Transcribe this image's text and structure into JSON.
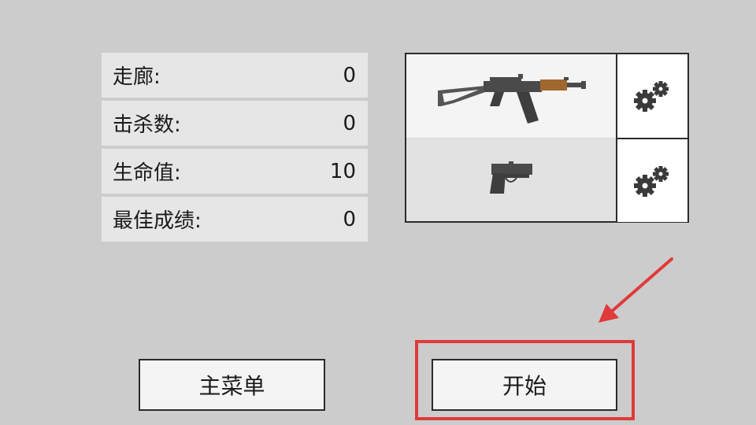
{
  "stats": [
    {
      "label": "走廊:",
      "value": "0"
    },
    {
      "label": "击杀数:",
      "value": "0"
    },
    {
      "label": "生命值:",
      "value": "10"
    },
    {
      "label": "最佳成绩:",
      "value": "0"
    }
  ],
  "weapons": {
    "primary": {
      "icon": "assault-rifle-icon",
      "settings_icon": "gears-icon"
    },
    "secondary": {
      "icon": "pistol-icon",
      "settings_icon": "gears-icon"
    }
  },
  "buttons": {
    "main_menu": "主菜单",
    "start": "开始"
  },
  "annotation": {
    "highlight_color": "#e03a3a"
  },
  "colors": {
    "background": "#cccccc",
    "panel": "#e6e6e6",
    "border": "#2b2b2b",
    "rifle_wood": "#a0672e"
  }
}
